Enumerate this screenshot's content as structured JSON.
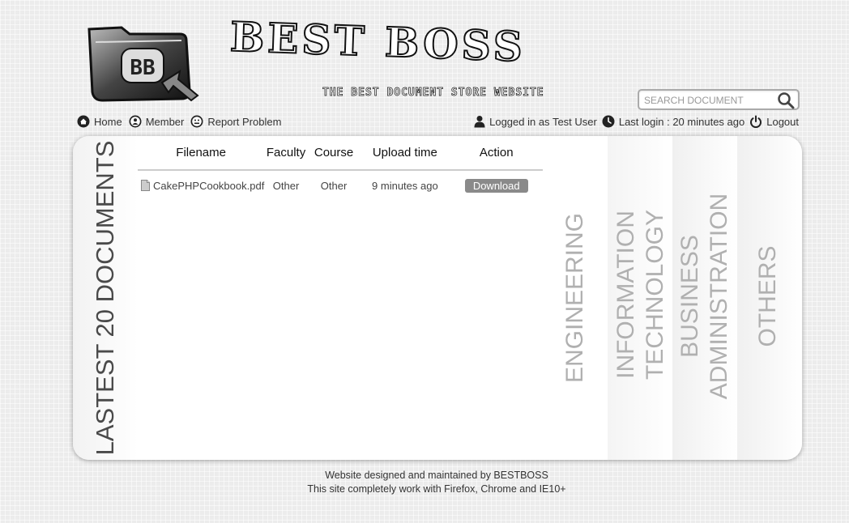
{
  "header": {
    "logo_text": "BB",
    "brand_title": "BEST BOSS",
    "tagline": "THE BEST DOCUMENT STORE WEBSITE"
  },
  "search": {
    "placeholder": "SEARCH DOCUMENT",
    "icon": "search-icon"
  },
  "nav_left": [
    {
      "label": "Home",
      "icon": "home-icon"
    },
    {
      "label": "Member",
      "icon": "member-icon"
    },
    {
      "label": "Report Problem",
      "icon": "report-icon"
    }
  ],
  "nav_right": {
    "logged_in": "Logged in as Test User",
    "last_login": "Last login : 20 minutes ago",
    "logout": "Logout"
  },
  "sidebar": {
    "label": "LASTEST 20 DOCUMENTS"
  },
  "documents": {
    "columns": [
      "Filename",
      "Faculty",
      "Course",
      "Upload time",
      "Action"
    ],
    "rows": [
      {
        "filename": "CakePHPCookbook.pdf",
        "faculty": "Other",
        "course": "Other",
        "upload_time": "9 minutes ago",
        "action": "Download"
      }
    ]
  },
  "faculties": [
    {
      "line1": "ENGINEERING",
      "line2": ""
    },
    {
      "line1": "INFORMATION",
      "line2": "TECHNOLOGY"
    },
    {
      "line1": "BUSINESS",
      "line2": "ADMINISTRATION"
    },
    {
      "line1": "OTHERS",
      "line2": ""
    }
  ],
  "footer": {
    "line1": "Website designed and maintained by BESTBOSS",
    "line2": "This site completely work with Firefox, Chrome and IE10+"
  },
  "colors": {
    "button_bg": "#8a8a8a",
    "faculty_text": "#b0b0b0",
    "page_bg": "#ececec"
  }
}
